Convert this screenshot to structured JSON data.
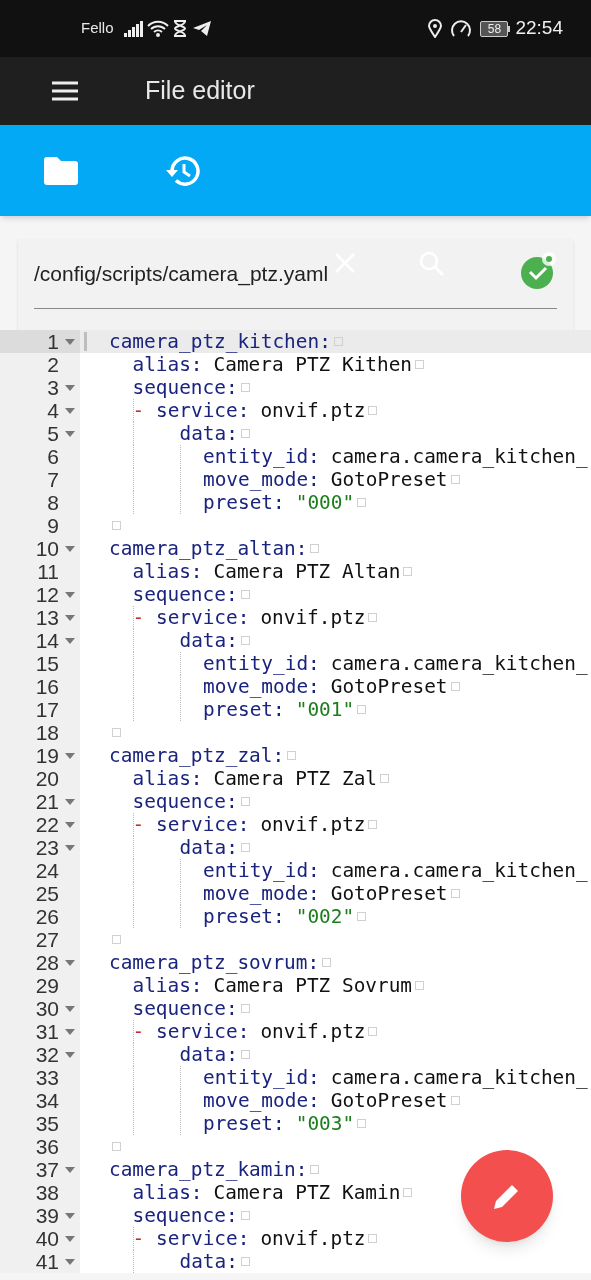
{
  "status_bar": {
    "carrier": "Fello",
    "battery": "58",
    "time": "22:54"
  },
  "app_bar": {
    "title": "File editor"
  },
  "file": {
    "path": "/config/scripts/camera_ptz.yaml"
  },
  "editor": {
    "lines": [
      {
        "number": "1",
        "foldable": true,
        "active": true,
        "key": "camera_ptz_kitchen:",
        "children": [
          {
            "number": "2",
            "foldable": false,
            "active": false,
            "key": "alias:",
            "value": "Camera PTZ Kithen",
            "kind": "plain"
          },
          {
            "number": "3",
            "foldable": true,
            "active": false,
            "key": "sequence:",
            "children": [
              {
                "number": "4",
                "foldable": true,
                "active": false,
                "marker": "-",
                "key": "service:",
                "value": "onvif.ptz",
                "kind": "plain",
                "children": [
                  {
                    "number": "5",
                    "foldable": true,
                    "active": false,
                    "key": "data:",
                    "children": [
                      {
                        "number": "6",
                        "foldable": false,
                        "active": false,
                        "key": "entity_id:",
                        "value": "camera.camera_kitchen_",
                        "kind": "plain",
                        "cut": true
                      },
                      {
                        "number": "7",
                        "foldable": false,
                        "active": false,
                        "key": "move_mode:",
                        "value": "GotoPreset",
                        "kind": "plain"
                      },
                      {
                        "number": "8",
                        "foldable": false,
                        "active": false,
                        "key": "preset:",
                        "value": "\"000\"",
                        "kind": "string"
                      }
                    ]
                  }
                ]
              }
            ]
          }
        ]
      },
      {
        "number": "9",
        "foldable": false,
        "active": false
      },
      {
        "number": "10",
        "foldable": true,
        "active": false,
        "key": "camera_ptz_altan:",
        "children": [
          {
            "number": "11",
            "foldable": false,
            "active": false,
            "key": "alias:",
            "value": "Camera PTZ Altan",
            "kind": "plain"
          },
          {
            "number": "12",
            "foldable": true,
            "active": false,
            "key": "sequence:",
            "children": [
              {
                "number": "13",
                "foldable": true,
                "active": false,
                "marker": "-",
                "key": "service:",
                "value": "onvif.ptz",
                "kind": "plain",
                "children": [
                  {
                    "number": "14",
                    "foldable": true,
                    "active": false,
                    "key": "data:",
                    "children": [
                      {
                        "number": "15",
                        "foldable": false,
                        "active": false,
                        "key": "entity_id:",
                        "value": "camera.camera_kitchen_",
                        "kind": "plain",
                        "cut": true
                      },
                      {
                        "number": "16",
                        "foldable": false,
                        "active": false,
                        "key": "move_mode:",
                        "value": "GotoPreset",
                        "kind": "plain"
                      },
                      {
                        "number": "17",
                        "foldable": false,
                        "active": false,
                        "key": "preset:",
                        "value": "\"001\"",
                        "kind": "string"
                      }
                    ]
                  }
                ]
              }
            ]
          }
        ]
      },
      {
        "number": "18",
        "foldable": false,
        "active": false
      },
      {
        "number": "19",
        "foldable": true,
        "active": false,
        "key": "camera_ptz_zal:",
        "children": [
          {
            "number": "20",
            "foldable": false,
            "active": false,
            "key": "alias:",
            "value": "Camera PTZ Zal",
            "kind": "plain"
          },
          {
            "number": "21",
            "foldable": true,
            "active": false,
            "key": "sequence:",
            "children": [
              {
                "number": "22",
                "foldable": true,
                "active": false,
                "marker": "-",
                "key": "service:",
                "value": "onvif.ptz",
                "kind": "plain",
                "children": [
                  {
                    "number": "23",
                    "foldable": true,
                    "active": false,
                    "key": "data:",
                    "children": [
                      {
                        "number": "24",
                        "foldable": false,
                        "active": false,
                        "key": "entity_id:",
                        "value": "camera.camera_kitchen_",
                        "kind": "plain",
                        "cut": true
                      },
                      {
                        "number": "25",
                        "foldable": false,
                        "active": false,
                        "key": "move_mode:",
                        "value": "GotoPreset",
                        "kind": "plain"
                      },
                      {
                        "number": "26",
                        "foldable": false,
                        "active": false,
                        "key": "preset:",
                        "value": "\"002\"",
                        "kind": "string"
                      }
                    ]
                  }
                ]
              }
            ]
          }
        ]
      },
      {
        "number": "27",
        "foldable": false,
        "active": false
      },
      {
        "number": "28",
        "foldable": true,
        "active": false,
        "key": "camera_ptz_sovrum:",
        "children": [
          {
            "number": "29",
            "foldable": false,
            "active": false,
            "key": "alias:",
            "value": "Camera PTZ Sovrum",
            "kind": "plain"
          },
          {
            "number": "30",
            "foldable": true,
            "active": false,
            "key": "sequence:",
            "children": [
              {
                "number": "31",
                "foldable": true,
                "active": false,
                "marker": "-",
                "key": "service:",
                "value": "onvif.ptz",
                "kind": "plain",
                "children": [
                  {
                    "number": "32",
                    "foldable": true,
                    "active": false,
                    "key": "data:",
                    "children": [
                      {
                        "number": "33",
                        "foldable": false,
                        "active": false,
                        "key": "entity_id:",
                        "value": "camera.camera_kitchen_",
                        "kind": "plain",
                        "cut": true
                      },
                      {
                        "number": "34",
                        "foldable": false,
                        "active": false,
                        "key": "move_mode:",
                        "value": "GotoPreset",
                        "kind": "plain"
                      },
                      {
                        "number": "35",
                        "foldable": false,
                        "active": false,
                        "key": "preset:",
                        "value": "\"003\"",
                        "kind": "string"
                      }
                    ]
                  }
                ]
              }
            ]
          }
        ]
      },
      {
        "number": "36",
        "foldable": false,
        "active": false
      },
      {
        "number": "37",
        "foldable": true,
        "active": false,
        "key": "camera_ptz_kamin:",
        "children": [
          {
            "number": "38",
            "foldable": false,
            "active": false,
            "key": "alias:",
            "value": "Camera PTZ Kamin",
            "kind": "plain"
          },
          {
            "number": "39",
            "foldable": true,
            "active": false,
            "key": "sequence:",
            "children": [
              {
                "number": "40",
                "foldable": true,
                "active": false,
                "marker": "-",
                "key": "service:",
                "value": "onvif.ptz",
                "kind": "plain",
                "children": [
                  {
                    "number": "41",
                    "foldable": true,
                    "active": false,
                    "key": "data:"
                  }
                ]
              }
            ]
          }
        ]
      }
    ]
  }
}
